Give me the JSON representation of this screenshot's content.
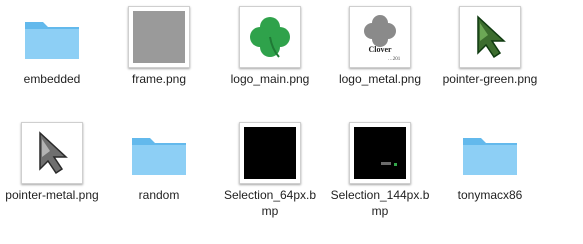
{
  "files": [
    {
      "label": "embedded",
      "kind": "folder"
    },
    {
      "label": "frame.png",
      "kind": "frame"
    },
    {
      "label": "logo_main.png",
      "kind": "clover-green"
    },
    {
      "label": "logo_metal.png",
      "kind": "clover-metal",
      "caption": "Clover",
      "caption_small": "…201"
    },
    {
      "label": "pointer-green.png",
      "kind": "pointer-green"
    },
    {
      "label": "pointer-metal.png",
      "kind": "pointer-metal"
    },
    {
      "label": "random",
      "kind": "folder"
    },
    {
      "label": "Selection_64px.b\nmp",
      "kind": "selection64"
    },
    {
      "label": "Selection_144px.b\nmp",
      "kind": "selection144"
    },
    {
      "label": "tonymacx86",
      "kind": "folder"
    }
  ],
  "colors": {
    "folder": "#6cc0f2",
    "folder_tab": "#8fd0f6"
  }
}
